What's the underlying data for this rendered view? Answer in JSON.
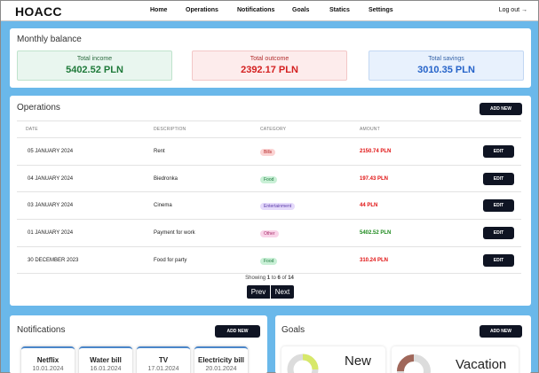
{
  "nav": {
    "brand": "HOACC",
    "links": [
      "Home",
      "Operations",
      "Notifications",
      "Goals",
      "Statics",
      "Settings"
    ],
    "logout": "Log out →"
  },
  "balance": {
    "title": "Monthly balance",
    "income": {
      "label": "Total income",
      "value": "5402.52 PLN"
    },
    "outcome": {
      "label": "Total outcome",
      "value": "2392.17 PLN"
    },
    "savings": {
      "label": "Total savings",
      "value": "3010.35 PLN"
    }
  },
  "operations": {
    "title": "Operations",
    "add_label": "ADD NEW",
    "columns": [
      "DATE",
      "DESCRIPTION",
      "CATEGORY",
      "AMOUNT"
    ],
    "rows": [
      {
        "date": "05 JANUARY 2024",
        "description": "Rent",
        "category": "Bills",
        "amount": "2150.74 PLN",
        "edit": "EDIT"
      },
      {
        "date": "04 JANUARY 2024",
        "description": "Biedronka",
        "category": "Food",
        "amount": "197.43 PLN",
        "edit": "EDIT"
      },
      {
        "date": "03 JANUARY 2024",
        "description": "Cinema",
        "category": "Entertainment",
        "amount": "44 PLN",
        "edit": "EDIT"
      },
      {
        "date": "01 JANUARY 2024",
        "description": "Payment for work",
        "category": "Other",
        "amount": "5402.52 PLN",
        "edit": "EDIT"
      },
      {
        "date": "30 DECEMBER 2023",
        "description": "Food for party",
        "category": "Food",
        "amount": "310.24 PLN",
        "edit": "EDIT"
      }
    ],
    "showing": {
      "prefix": "Showing",
      "from": "1",
      "to_word": "to",
      "to": "6",
      "of_word": "of",
      "total": "14"
    },
    "prev_label": "Prev",
    "next_label": "Next"
  },
  "notifications": {
    "title": "Notifications",
    "add_label": "ADD NEW",
    "items": [
      {
        "name": "Netflix",
        "date": "10.01.2024"
      },
      {
        "name": "Water bill",
        "date": "16.01.2024"
      },
      {
        "name": "TV",
        "date": "17.01.2024"
      },
      {
        "name": "Electricity bill",
        "date": "20.01.2024"
      }
    ]
  },
  "goals": {
    "title": "Goals",
    "add_label": "ADD NEW",
    "items": [
      {
        "name": "New"
      },
      {
        "name": "Vacation"
      }
    ]
  },
  "colors": {
    "background": "#6ab8ea",
    "dark_button": "#0f1423",
    "income": "#1f7a3a",
    "outcome": "#d42020",
    "savings": "#2563c9",
    "negative_amount": "#e01010",
    "positive_amount": "#1e8a1e"
  },
  "icons": [
    "logout-arrow-icon",
    "donut-chart-icon"
  ]
}
